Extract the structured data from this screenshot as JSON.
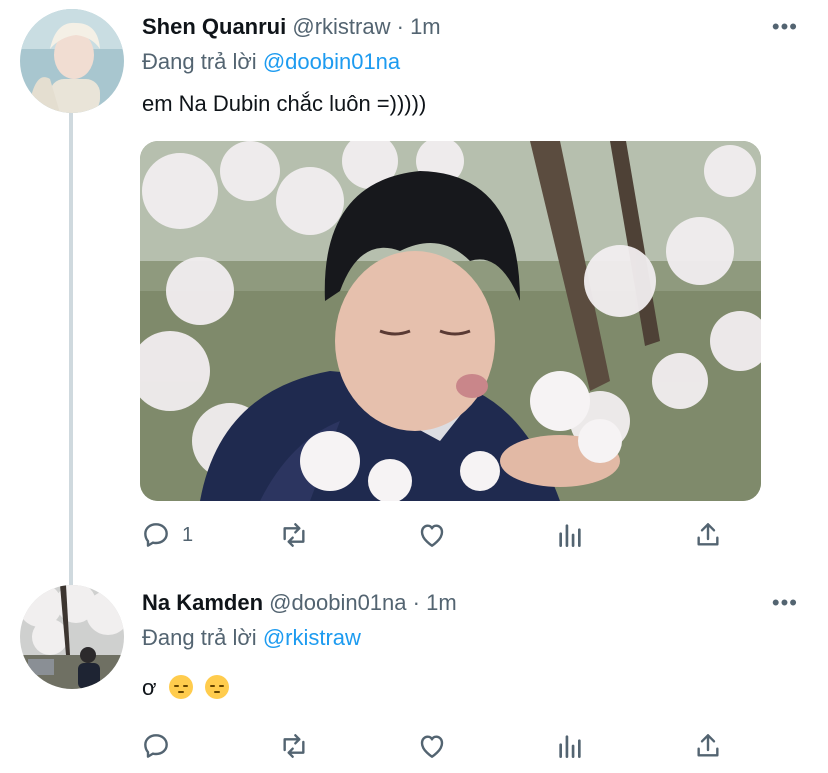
{
  "tweets": [
    {
      "name": "Shen Quanrui",
      "handle": "@rkistraw",
      "separator": "·",
      "time": "1m",
      "reply_prefix": "Đang trả lời ",
      "reply_to": "@doobin01na",
      "text": "em Na Dubin chắc luôn =)))))",
      "reply_count": "1",
      "more": "•••"
    },
    {
      "name": "Na Kamden",
      "handle": "@doobin01na",
      "separator": "·",
      "time": "1m",
      "reply_prefix": "Đang trả lời ",
      "reply_to": "@rkistraw",
      "text": "ơ",
      "reply_count": "",
      "more": "•••"
    }
  ],
  "icons": [
    "reply-icon",
    "retweet-icon",
    "like-icon",
    "analytics-icon",
    "share-icon"
  ],
  "colors": {
    "accent": "#1d9bf0",
    "muted": "#536471",
    "text": "#0f1419",
    "thread_line": "#cfd9de"
  }
}
